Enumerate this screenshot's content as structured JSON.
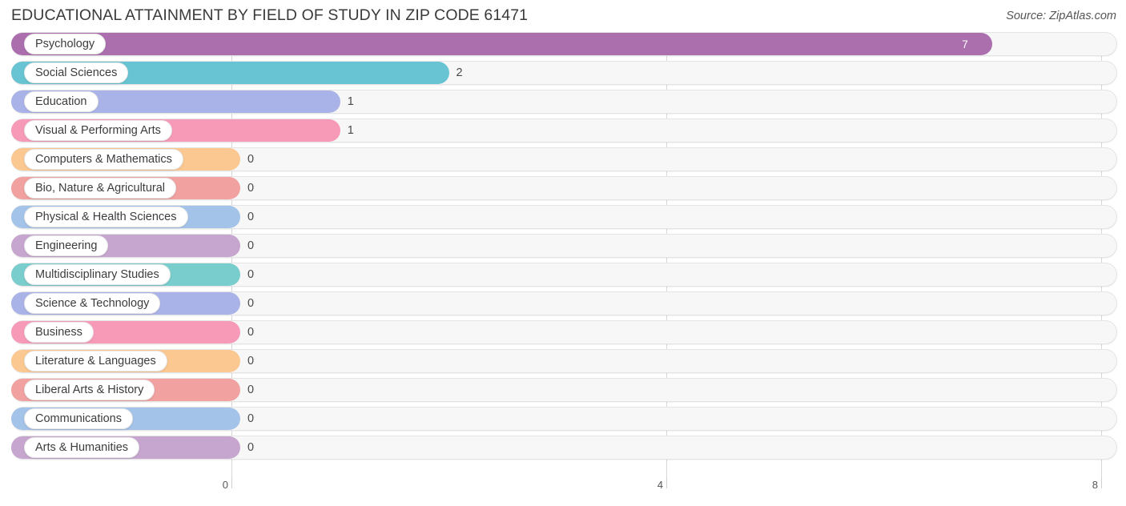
{
  "header": {
    "title": "EDUCATIONAL ATTAINMENT BY FIELD OF STUDY IN ZIP CODE 61471",
    "source": "Source: ZipAtlas.com"
  },
  "chart_data": {
    "type": "bar",
    "orientation": "horizontal",
    "title": "EDUCATIONAL ATTAINMENT BY FIELD OF STUDY IN ZIP CODE 61471",
    "xlabel": "",
    "ylabel": "",
    "xlim": [
      0,
      8.15
    ],
    "xticks": [
      0,
      4,
      8
    ],
    "xtick_labels": [
      "0",
      "4",
      "8"
    ],
    "grid": true,
    "legend": false,
    "categories": [
      "Psychology",
      "Social Sciences",
      "Education",
      "Visual & Performing Arts",
      "Computers & Mathematics",
      "Bio, Nature & Agricultural",
      "Physical & Health Sciences",
      "Engineering",
      "Multidisciplinary Studies",
      "Science & Technology",
      "Business",
      "Literature & Languages",
      "Liberal Arts & History",
      "Communications",
      "Arts & Humanities"
    ],
    "values": [
      7,
      2,
      1,
      1,
      0,
      0,
      0,
      0,
      0,
      0,
      0,
      0,
      0,
      0,
      0
    ],
    "value_labels": [
      "7",
      "2",
      "1",
      "1",
      "0",
      "0",
      "0",
      "0",
      "0",
      "0",
      "0",
      "0",
      "0",
      "0",
      "0"
    ],
    "colors": [
      "#ab6fae",
      "#68c4d2",
      "#aab3e8",
      "#f79ab8",
      "#fbc891",
      "#f0a1a0",
      "#a4c3e8",
      "#c6a6cf",
      "#79cdcd",
      "#aab3e8",
      "#f79ab8",
      "#fbc891",
      "#f0a1a0",
      "#a4c3e8",
      "#c6a6cf"
    ]
  }
}
